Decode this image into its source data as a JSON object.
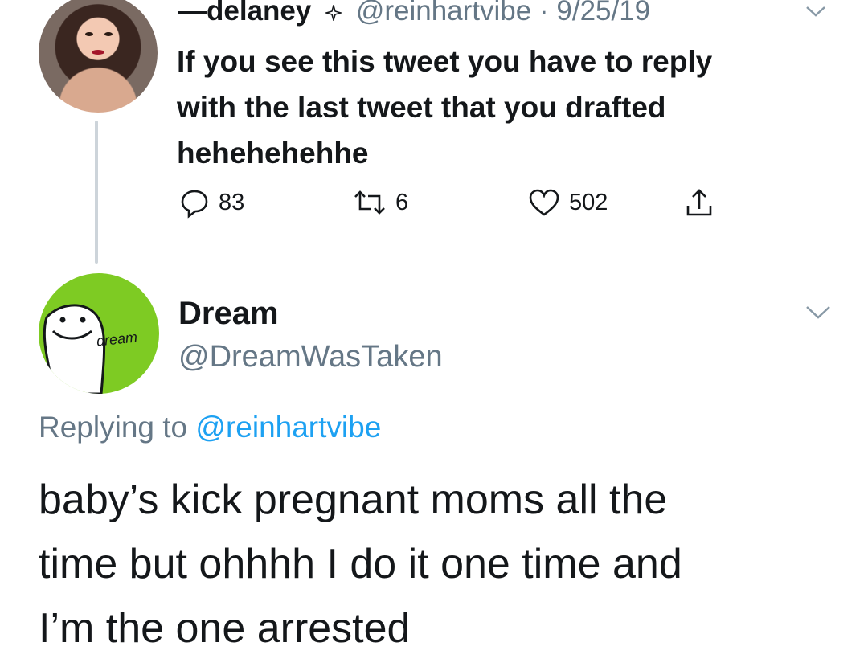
{
  "tweet1": {
    "name": "—delaney",
    "handle": "@reinhartvibe",
    "separator": "·",
    "date": "9/25/19",
    "text_lines": [
      "If you see this tweet you have to reply",
      "with the last tweet that you drafted",
      "hehehehehhe"
    ],
    "replies": "83",
    "retweets": "6",
    "likes": "502",
    "icons": [
      "sparkle-icon",
      "chevron-down-icon",
      "reply-icon",
      "retweet-icon",
      "heart-icon",
      "share-icon"
    ]
  },
  "tweet2": {
    "avatar_label": "dream",
    "name": "Dream",
    "handle": "@DreamWasTaken",
    "replying_prefix": "Replying to",
    "replying_handle": "@reinhartvibe",
    "text_lines": [
      "baby’s kick pregnant moms all the",
      "time but ohhhh I do it one time and",
      "I’m the one arrested"
    ]
  },
  "colors": {
    "text": "#14171a",
    "secondary": "#657786",
    "link": "#1da1f2",
    "thread_line": "#cdd4da",
    "dream_green": "#7ecb23"
  }
}
